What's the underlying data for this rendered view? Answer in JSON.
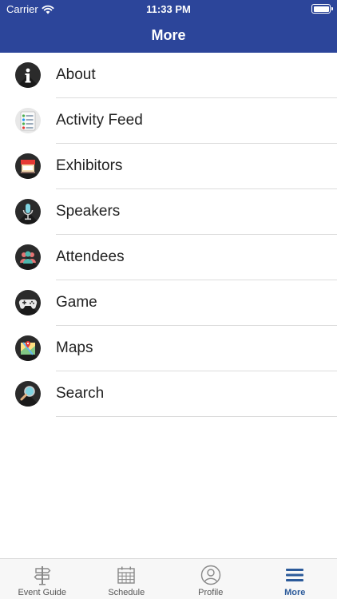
{
  "status_bar": {
    "carrier": "Carrier",
    "time": "11:33 PM"
  },
  "header": {
    "title": "More"
  },
  "menu": [
    {
      "label": "About",
      "icon": "info-icon"
    },
    {
      "label": "Activity Feed",
      "icon": "activity-feed-icon"
    },
    {
      "label": "Exhibitors",
      "icon": "exhibitors-icon"
    },
    {
      "label": "Speakers",
      "icon": "microphone-icon"
    },
    {
      "label": "Attendees",
      "icon": "attendees-icon"
    },
    {
      "label": "Game",
      "icon": "gamepad-icon"
    },
    {
      "label": "Maps",
      "icon": "map-icon"
    },
    {
      "label": "Search",
      "icon": "search-icon"
    }
  ],
  "tabbar": {
    "active": "More",
    "tabs": [
      {
        "label": "Event Guide",
        "icon": "signpost-icon"
      },
      {
        "label": "Schedule",
        "icon": "calendar-icon"
      },
      {
        "label": "Profile",
        "icon": "profile-icon"
      },
      {
        "label": "More",
        "icon": "menu-icon"
      }
    ]
  },
  "colors": {
    "header": "#2c459a",
    "active_tab": "#2b5a9a"
  }
}
